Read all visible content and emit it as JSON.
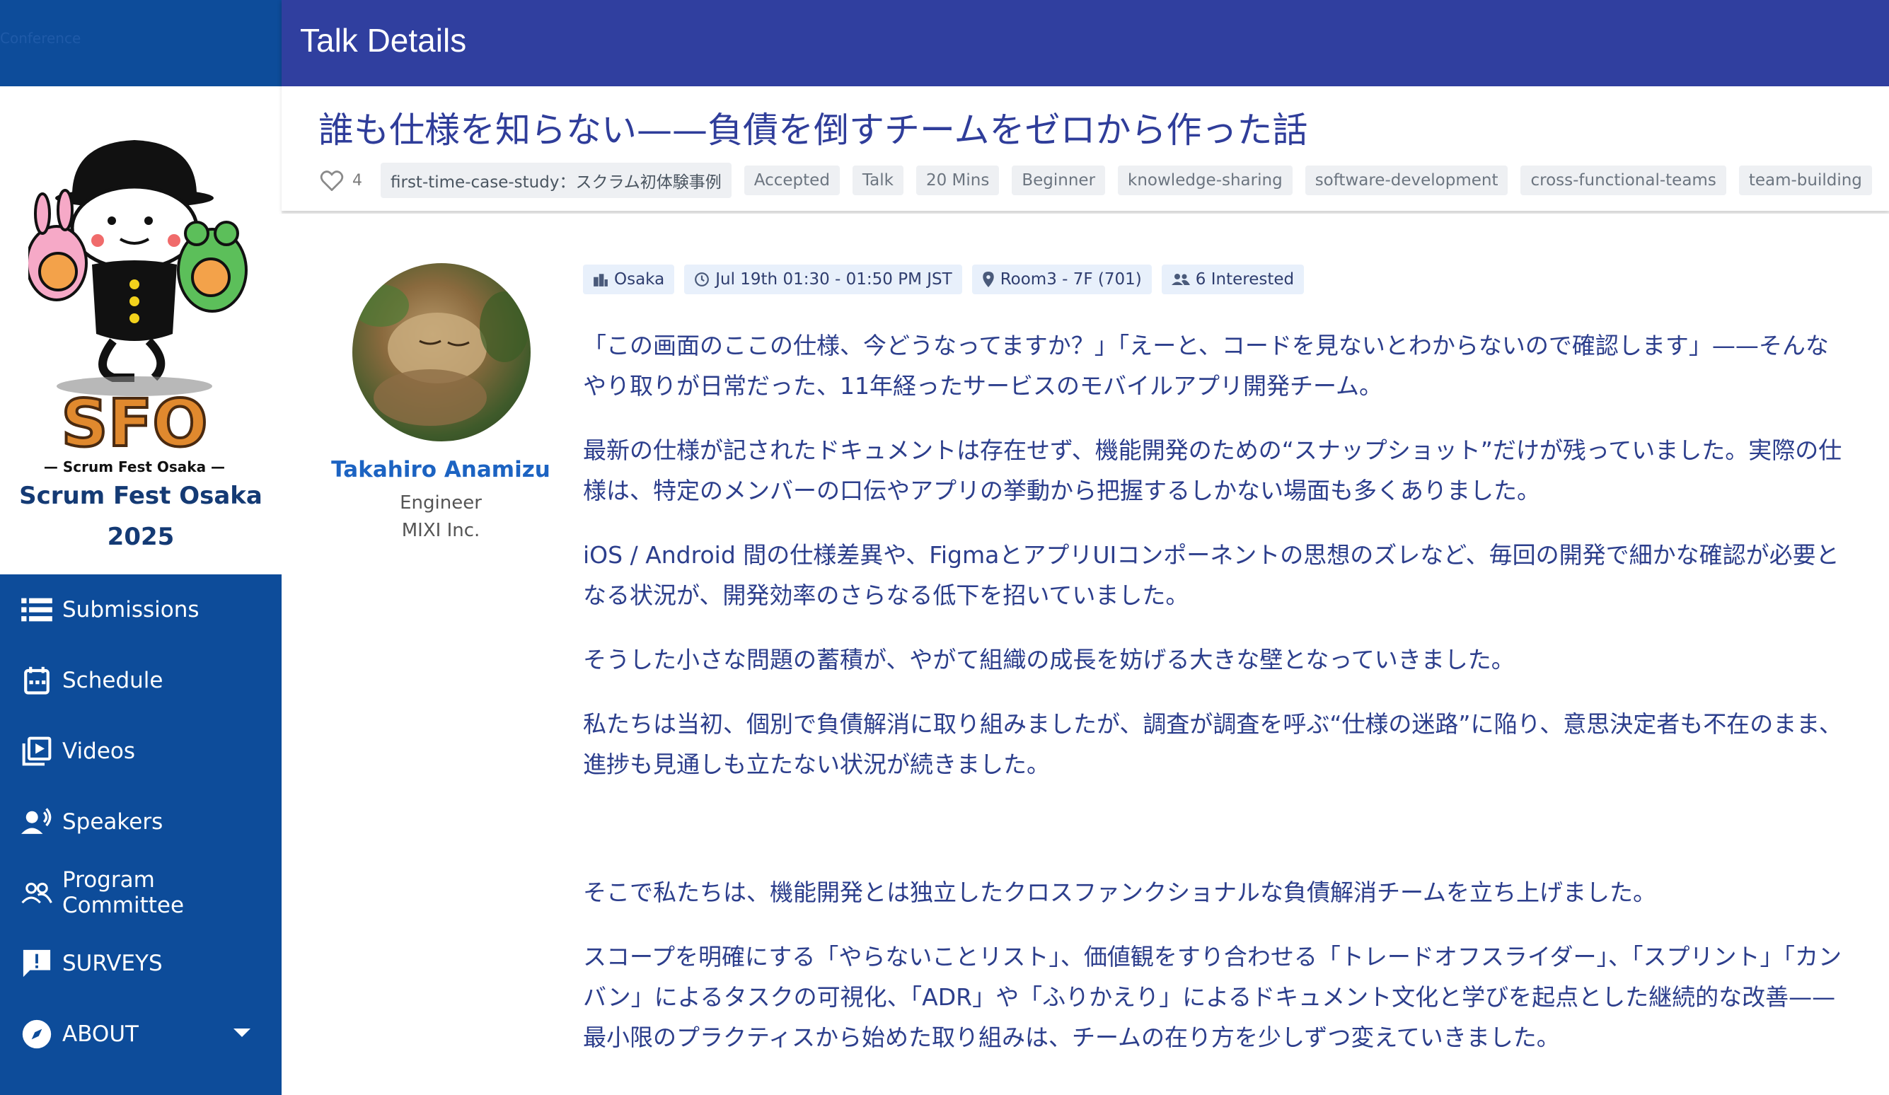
{
  "sidebar": {
    "ghost_text": "Conference",
    "brand_logo_text": "SFO",
    "brand_logo_sub": "— Scrum Fest Osaka —",
    "brand_name": "Scrum Fest Osaka 2025",
    "items": [
      {
        "label": "Submissions",
        "icon": "list-icon"
      },
      {
        "label": "Schedule",
        "icon": "calendar-icon"
      },
      {
        "label": "Videos",
        "icon": "video-library-icon"
      },
      {
        "label": "Speakers",
        "icon": "speaker-icon"
      },
      {
        "label": "Program Committee",
        "icon": "people-icon"
      },
      {
        "label": "SURVEYS",
        "icon": "feedback-icon"
      },
      {
        "label": "ABOUT",
        "icon": "compass-icon",
        "expandable": true
      }
    ]
  },
  "header": {
    "title": "Talk Details"
  },
  "talk": {
    "title": "誰も仕様を知らない——負債を倒すチームをゼロから作った話",
    "likes": "4",
    "tags": [
      "first-time-case-study：スクラム初体験事例",
      "Accepted",
      "Talk",
      "20 Mins",
      "Beginner",
      "knowledge-sharing",
      "software-development",
      "cross-functional-teams",
      "team-building"
    ],
    "meta": {
      "location": "Osaka",
      "time": "Jul 19th 01:30 - 01:50 PM JST",
      "room": "Room3 - 7F (701)",
      "interested": "6 Interested"
    },
    "speaker": {
      "name": "Takahiro Anamizu",
      "role": "Engineer",
      "company": "MIXI Inc."
    },
    "description": [
      "「この画面のここの仕様、今どうなってますか？」「えーと、コードを見ないとわからないので確認します」——そんなやり取りが日常だった、11年経ったサービスのモバイルアプリ開発チーム。",
      "最新の仕様が記されたドキュメントは存在せず、機能開発のための“スナップショット”だけが残っていました。実際の仕様は、特定のメンバーの口伝やアプリの挙動から把握するしかない場面も多くありました。",
      "iOS / Android 間の仕様差異や、FigmaとアプリUIコンポーネントの思想のズレなど、毎回の開発で細かな確認が必要となる状況が、開発効率のさらなる低下を招いていました。",
      "そうした小さな問題の蓄積が、やがて組織の成長を妨げる大きな壁となっていきました。",
      "私たちは当初、個別で負債解消に取り組みましたが、調査が調査を呼ぶ“仕様の迷路”に陥り、意思決定者も不在のまま、進捗も見通しも立たない状況が続きました。",
      "そこで私たちは、機能開発とは独立したクロスファンクショナルな負債解消チームを立ち上げました。",
      "スコープを明確にする「やらないことリスト」、価値観をすり合わせる「トレードオフスライダー」、「スプリント」「カンバン」によるタスクの可視化、「ADR」や「ふりかえり」によるドキュメント文化と学びを起点とした継続的な改善——最小限のプラクティスから始めた取り組みは、チームの在り方を少しずつ変えていきました。"
    ]
  },
  "colors": {
    "appbar": "#303f9f",
    "sidebar": "#0d4c9a",
    "title_text": "#2f3d9a",
    "speaker_link": "#1c63c2"
  }
}
